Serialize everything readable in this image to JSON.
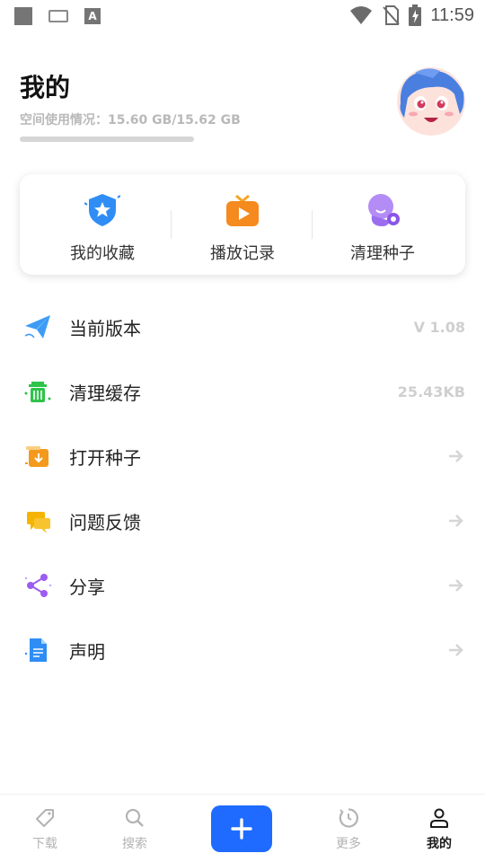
{
  "status_bar": {
    "time": "11:59"
  },
  "header": {
    "title": "我的",
    "storage_text": "空间使用情况：15.60 GB/15.62 GB",
    "storage_used_fraction": 0.9987
  },
  "quick_actions": [
    {
      "label": "我的收藏",
      "icon": "shield-star-icon"
    },
    {
      "label": "播放记录",
      "icon": "tv-play-icon"
    },
    {
      "label": "清理种子",
      "icon": "seed-clean-icon"
    }
  ],
  "menu": [
    {
      "label": "当前版本",
      "value": "V 1.08",
      "icon": "paper-plane-icon"
    },
    {
      "label": "清理缓存",
      "value": "25.43KB",
      "icon": "trash-icon"
    },
    {
      "label": "打开种子",
      "value": "",
      "icon": "open-box-icon"
    },
    {
      "label": "问题反馈",
      "value": "",
      "icon": "chat-bubble-icon"
    },
    {
      "label": "分享",
      "value": "",
      "icon": "share-icon"
    },
    {
      "label": "声明",
      "value": "",
      "icon": "document-icon"
    }
  ],
  "bottom_nav": {
    "items": [
      {
        "label": "下载",
        "icon": "tag-icon",
        "active": false
      },
      {
        "label": "搜索",
        "icon": "search-icon",
        "active": false
      },
      {
        "label": "更多",
        "icon": "clock-icon",
        "active": false
      },
      {
        "label": "我的",
        "icon": "user-icon",
        "active": true
      }
    ],
    "fab_icon": "plus-icon"
  },
  "colors": {
    "accent": "#1f6bff",
    "muted_text": "#b9b9b9",
    "value_text": "#cfcfcf"
  }
}
